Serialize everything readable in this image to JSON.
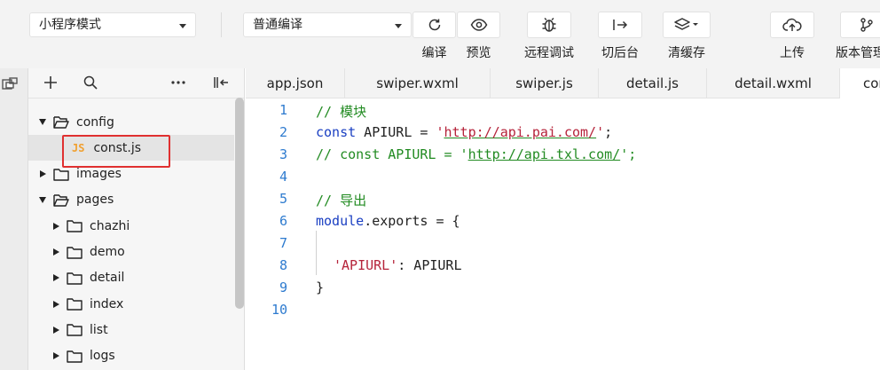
{
  "toolbar": {
    "mode_select": "小程序模式",
    "compile_select": "普通编译",
    "buttons": {
      "compile": "编译",
      "preview": "预览",
      "remote_debug": "远程调试",
      "background": "切后台",
      "clear_cache": "清缓存",
      "upload": "上传",
      "version": "版本管理"
    }
  },
  "tree": {
    "items": [
      {
        "label": "config",
        "type": "folder",
        "expanded": true
      },
      {
        "label": "const.js",
        "type": "js-file"
      },
      {
        "label": "images",
        "type": "folder",
        "expanded": false
      },
      {
        "label": "pages",
        "type": "folder",
        "expanded": true
      },
      {
        "label": "chazhi",
        "type": "folder",
        "expanded": false
      },
      {
        "label": "demo",
        "type": "folder",
        "expanded": false
      },
      {
        "label": "detail",
        "type": "folder",
        "expanded": false
      },
      {
        "label": "index",
        "type": "folder",
        "expanded": false
      },
      {
        "label": "list",
        "type": "folder",
        "expanded": false
      },
      {
        "label": "logs",
        "type": "folder",
        "expanded": false
      }
    ],
    "js_badge": "JS"
  },
  "tabs": [
    "app.json",
    "swiper.wxml",
    "swiper.js",
    "detail.js",
    "detail.wxml",
    "const.js"
  ],
  "editor": {
    "line_numbers": [
      "1",
      "2",
      "3",
      "4",
      "5",
      "6",
      "7",
      "8",
      "9",
      "10"
    ],
    "line1": "// 模块",
    "line2": {
      "kw": "const",
      "rest": " APIURL = ",
      "q1": "'",
      "url": "http://api.pai.com/",
      "q2": "'",
      "end": ";"
    },
    "line3": {
      "prefix": "// const APIURL = '",
      "url": "http://api.txl.com/",
      "end": "';"
    },
    "line5": "// 导出",
    "line6": {
      "obj": "module",
      "rest": ".exports = {"
    },
    "line8": {
      "key": "'APIURL'",
      "rest": ": APIURL"
    },
    "line9": "}"
  },
  "colors": {
    "comment": "#228b22",
    "keyword": "#1a3fc2",
    "string": "#b5233a",
    "line_number": "#2e7bcf",
    "highlight_box": "#e03030"
  }
}
